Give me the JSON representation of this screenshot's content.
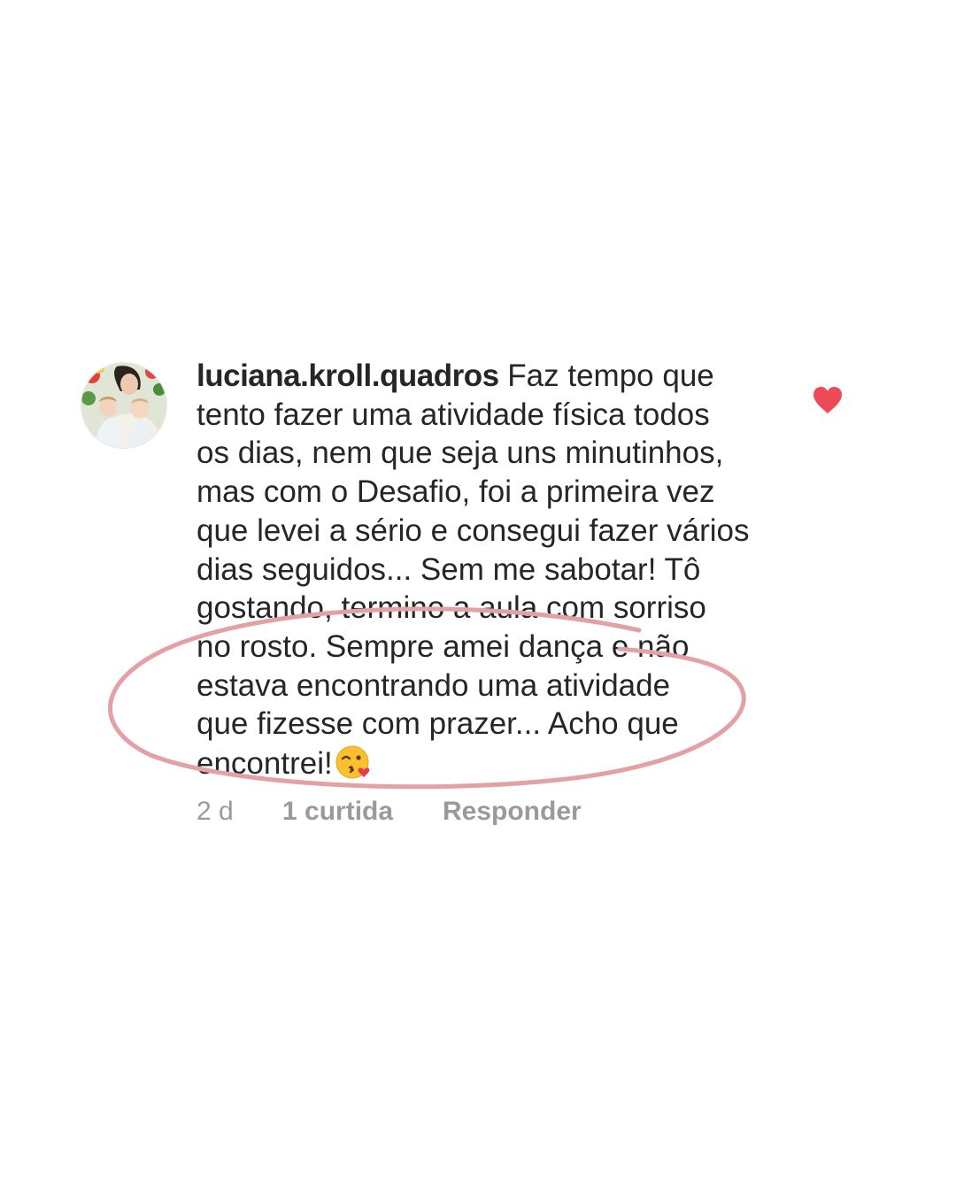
{
  "comment": {
    "username": "luciana.kroll.quadros",
    "text_lines": [
      "Faz tempo que",
      "tento fazer uma atividade física todos",
      "os dias, nem que seja uns minutinhos,",
      "mas com o Desafio, foi a primeira vez",
      "que levei a sério e consegui fazer vários",
      "dias seguidos... Sem me sabotar! Tô",
      "gostando, termino a aula com sorriso",
      "no rosto. Sempre amei dança e não",
      "estava encontrando uma atividade",
      "que fizesse com prazer... Acho que",
      "encontrei!"
    ],
    "emoji": "kissing-face-with-heart-emoji",
    "liked": true,
    "like_icon": "heart-icon",
    "like_color": "#ed4956",
    "meta": {
      "time": "2 d",
      "likes": "1 curtida",
      "reply": "Responder"
    }
  },
  "annotation": {
    "color": "#e3a1a5"
  }
}
